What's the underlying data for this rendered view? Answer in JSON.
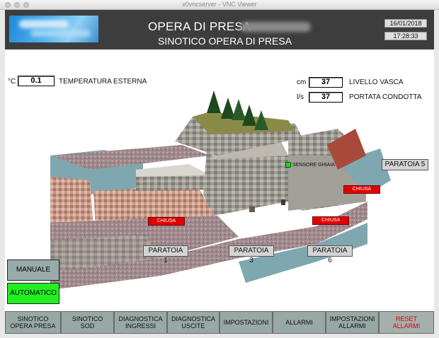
{
  "window": {
    "title": "x0vncserver - VNC Viewer"
  },
  "header": {
    "title": "OPERA DI PRESA",
    "subtitle": "SINOTICO OPERA DI PRESA",
    "date": "16/01/2018",
    "time": "17:28:33"
  },
  "indicators": {
    "temperature": {
      "unit": "°C",
      "value": "0.1",
      "label": "TEMPERATURA ESTERNA"
    },
    "level": {
      "unit": "cm",
      "value": "37",
      "label": "LIVELLO VASCA"
    },
    "flow": {
      "unit": "l/s",
      "value": "37",
      "label": "PORTATA CONDOTTA"
    }
  },
  "scene": {
    "sensor_label": "SENSORE GHIAIA",
    "gates": [
      {
        "name": "PARATOIA 1",
        "status": "CHIUSA"
      },
      {
        "name": "PARATOIA 3"
      },
      {
        "name": "PARATOIA 5",
        "status": "CHIUSA"
      },
      {
        "name": "PARATOIA 6",
        "status": "CHIUSA"
      }
    ]
  },
  "modes": {
    "manual": "MANUALE",
    "automatic": "AUTOMATICO",
    "automatic_active_color": "#22ee22"
  },
  "nav": [
    {
      "line1": "SINOTICO",
      "line2": "OPERA PRESA"
    },
    {
      "line1": "SINOTICO",
      "line2": "SOD"
    },
    {
      "line1": "DIAGNOSTICA",
      "line2": "INGRESSI"
    },
    {
      "line1": "DIAGNOSTICA",
      "line2": "USCITE"
    },
    {
      "line1": "IMPOSTAZIONI",
      "line2": ""
    },
    {
      "line1": "ALLARMI",
      "line2": ""
    },
    {
      "line1": "IMPOSTAZIONI",
      "line2": "ALLARMI"
    },
    {
      "line1": "RESET",
      "line2": "ALLARMI"
    }
  ]
}
